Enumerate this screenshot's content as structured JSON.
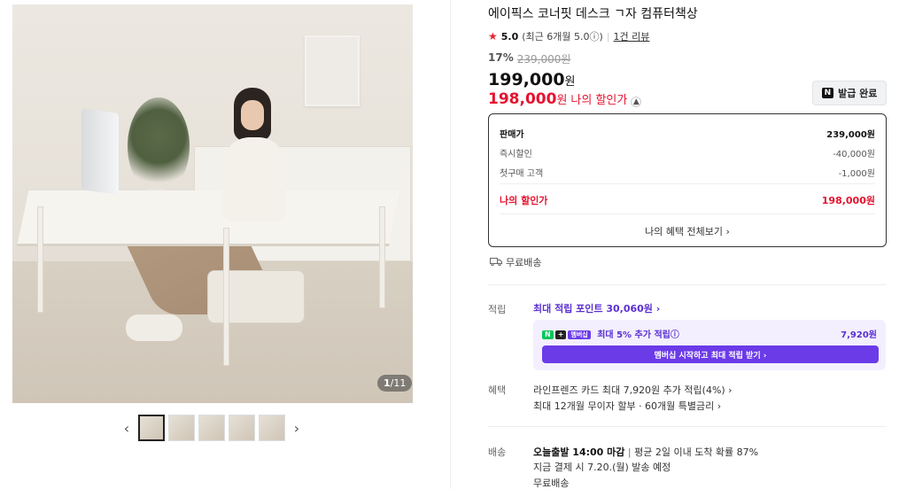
{
  "gallery": {
    "counter_current": "1",
    "counter_total": "/11",
    "thumbnail_count": 5,
    "prev_glyph": "‹",
    "next_glyph": "›"
  },
  "product": {
    "title": "에이픽스 코너핏 데스크 ㄱ자 컴퓨터책상",
    "rating_score": "5.0",
    "rating_detail": "(최근 6개월 5.0ⓘ)",
    "review_link": "1건 리뷰",
    "discount_pct": "17%",
    "original_price": "239,000원",
    "price_value": "199,000",
    "price_unit": "원",
    "my_price_value": "198,000",
    "my_price_unit": "원",
    "my_price_label": "나의 할인가",
    "coupon_button": "발급 완료",
    "coupon_badge": "N"
  },
  "breakdown": {
    "head_label": "판매가",
    "head_value": "239,000원",
    "rows": [
      {
        "label": "즉시할인",
        "value": "-40,000원"
      },
      {
        "label": "첫구매 고객",
        "value": "-1,000원"
      }
    ],
    "my_label": "나의 할인가",
    "my_value": "198,000원",
    "more_link": "나의 혜택 전체보기 ›"
  },
  "shipping_free": "무료배송",
  "points": {
    "label": "적립",
    "max_link": "최대 적립 포인트 30,060원 ›",
    "member_text": "최대 5% 추가 적립ⓘ",
    "member_amount": "7,920원",
    "member_tag_n": "N",
    "member_tag_plus": "+",
    "member_tag_m": "멤버십",
    "member_button": "멤버십 시작하고 최대 적립 받기 ›"
  },
  "benefits": {
    "label": "혜택",
    "line1": "라인프렌즈 카드 최대 7,920원 추가 적립(4%) ›",
    "line2": "최대 12개월 무이자 할부 · 60개월 특별금리 ›"
  },
  "delivery": {
    "label": "배송",
    "deadline": "오늘출발 14:00 마감",
    "arrival": "평균 2일 이내 도착 확률 87%",
    "line2": "지금 결제 시 7.20.(월) 발송 예정",
    "line3": "무료배송"
  },
  "colors": {
    "accent_red": "#e6132f",
    "accent_purple": "#6b3be8",
    "naver_green": "#03c75a"
  },
  "icons": [
    "star-icon",
    "info-icon",
    "chevron-up-icon",
    "truck-icon",
    "chevron-left-icon",
    "chevron-right-icon"
  ]
}
